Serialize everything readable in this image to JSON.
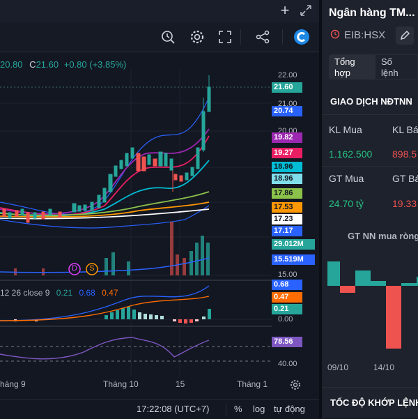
{
  "window": {
    "add_icon": "plus-icon",
    "expand_icon": "expand-icon"
  },
  "toolbar": {
    "icons": [
      "alert-icon",
      "gear-icon",
      "fullscreen-icon",
      "share-icon",
      "app-logo-icon"
    ]
  },
  "ohlc": {
    "fragment": "20.80",
    "close_label": "C",
    "close": "21.60",
    "change": "+0.80 (+3.85%)"
  },
  "price_axis": {
    "labels": [
      "22.00",
      "21.00",
      "20.00",
      "15.00",
      "0.00",
      "40.00"
    ],
    "tags": [
      {
        "value": "21.60",
        "bg": "#26a69a",
        "fg": "#ffffff"
      },
      {
        "value": "20.74",
        "bg": "#2962ff",
        "fg": "#ffffff"
      },
      {
        "value": "19.82",
        "bg": "#9c27b0",
        "fg": "#ffffff"
      },
      {
        "value": "19.27",
        "bg": "#e91e63",
        "fg": "#ffffff"
      },
      {
        "value": "18.96",
        "bg": "#00bcd4",
        "fg": "#131722"
      },
      {
        "value": "18.96",
        "bg": "#80deea",
        "fg": "#131722"
      },
      {
        "value": "17.86",
        "bg": "#8bc34a",
        "fg": "#131722"
      },
      {
        "value": "17.53",
        "bg": "#ff9800",
        "fg": "#131722"
      },
      {
        "value": "17.23",
        "bg": "#ffffff",
        "fg": "#131722"
      },
      {
        "value": "17.17",
        "bg": "#2962ff",
        "fg": "#ffffff"
      },
      {
        "value": "29.012M",
        "bg": "#26a69a",
        "fg": "#ffffff"
      },
      {
        "value": "15.519M",
        "bg": "#2962ff",
        "fg": "#ffffff"
      },
      {
        "value": "0.68",
        "bg": "#2962ff",
        "fg": "#ffffff"
      },
      {
        "value": "0.47",
        "bg": "#ff6d00",
        "fg": "#ffffff"
      },
      {
        "value": "0.21",
        "bg": "#26a69a",
        "fg": "#ffffff"
      },
      {
        "value": "78.56",
        "bg": "#7e57c2",
        "fg": "#ffffff"
      }
    ]
  },
  "macd": {
    "params": "12 26 close 9",
    "v1": "0.21",
    "v2": "0.68",
    "v3": "0.47"
  },
  "markers": {
    "d": "D",
    "s": "S"
  },
  "x_axis": {
    "labels": [
      "háng 9",
      "Tháng 10",
      "15",
      "Tháng 1"
    ]
  },
  "bottom": {
    "time": "17:22:08 (UTC+7)",
    "percent": "%",
    "log": "log",
    "auto": "tự động"
  },
  "sidebar": {
    "title": "Ngân hàng TM...",
    "ticker": "EIB:HSX",
    "tab1_l1": "Tổng",
    "tab1_l2": "hợp",
    "tab2_l1": "Số",
    "tab2_l2": "lệnh",
    "section_title": "GIAO DỊCH NĐTNN",
    "kl_mua_label": "KL Mua",
    "kl_ban_label": "KL Bán",
    "kl_mua_value": "1.162.500",
    "kl_ban_value": "898.5",
    "gt_mua_label": "GT Mua",
    "gt_ban_label": "GT Bán",
    "gt_mua_value": "24.70 tỷ",
    "gt_ban_value": "19.33",
    "chart_title": "GT NN mua ròng",
    "chart_x": [
      "09/10",
      "14/10"
    ],
    "speed_title": "TỐC ĐỘ KHỚP LỆNH"
  },
  "chart_data": {
    "type": "bar",
    "title": "GT NN mua ròng",
    "categories": [
      "",
      "09/10",
      "",
      "",
      "14/10",
      "",
      ""
    ],
    "values": [
      3.5,
      -1,
      2.2,
      0.7,
      -9,
      0.4,
      1.3
    ],
    "colors": [
      "#26a69a",
      "#ef5350",
      "#26a69a",
      "#26a69a",
      "#ef5350",
      "#26a69a",
      "#26a69a"
    ]
  }
}
